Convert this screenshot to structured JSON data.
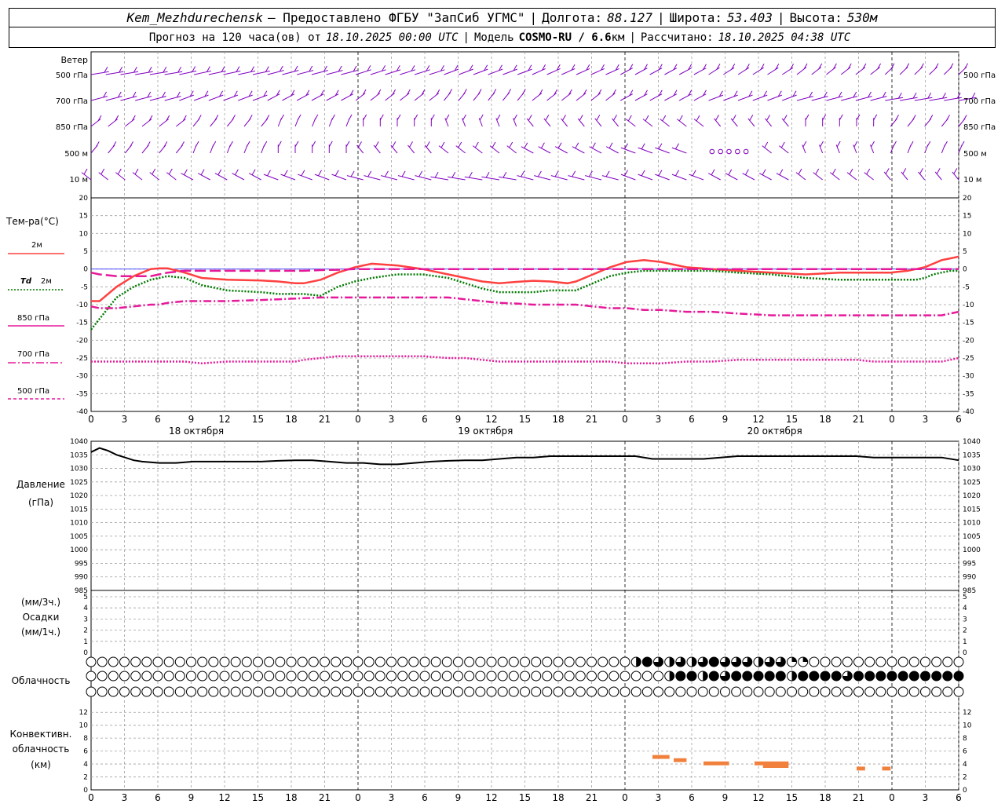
{
  "header": {
    "station": "Kem_Mezhdurechensk",
    "provider": "— Предоставлено ФГБУ \"ЗапСиб УГМС\"",
    "lon_label": "Долгота:",
    "lon_value": "88.127",
    "lat_label": "Широта:",
    "lat_value": "53.403",
    "alt_label": "Высота:",
    "alt_value": "530м",
    "forecast_prefix": "Прогноз на 120 часа(ов) от",
    "forecast_start": "18.10.2025 00:00 UTC",
    "model_label": "Модель",
    "model_name": "COSMO-RU / 6.6",
    "model_unit": "км",
    "calc_label": "Рассчитано:",
    "calc_time": "18.10.2025 04:38 UTC"
  },
  "labels": {
    "wind": "Ветер",
    "wind_levels": [
      "500 гПа",
      "700 гПа",
      "850 гПа",
      "500 м",
      "10 м"
    ],
    "temp_title": "Тем-ра(°С)",
    "t2m": "2м",
    "td_a": "Td",
    "td_b": "2м",
    "t850": "850 гПа",
    "t700": "700 гПа",
    "t500": "500 гПа",
    "pressure_a": "Давление",
    "pressure_b": "(гПа)",
    "precip_a": "(мм/3ч.)",
    "precip_b": "Осадки",
    "precip_c": "(мм/1ч.)",
    "cloud": "Облачность",
    "conv_a": "Конвективн.",
    "conv_b": "облачность",
    "conv_c": "(км)"
  },
  "colors": {
    "t2m": "#ff4040",
    "td2m": "#007a00",
    "t850": "#e6199a",
    "t700": "#e6199a",
    "t500": "#e6199a",
    "wind": "#8000c0",
    "pressure": "#000000",
    "convective": "#f0803c",
    "zero_line": "#3030ff",
    "grid": "#a0a0a0"
  },
  "chart_data": [
    {
      "type": "line",
      "panel": "temperature",
      "x_hours": [
        0,
        1,
        3,
        5,
        7,
        8,
        9,
        11,
        13,
        16,
        20,
        22,
        24,
        25,
        27,
        29,
        31,
        32,
        33,
        36,
        39,
        42,
        44,
        46,
        48,
        50,
        52,
        54,
        56,
        57,
        59,
        61,
        63,
        65,
        67,
        70,
        73,
        76,
        80,
        84,
        88,
        90,
        92,
        94,
        96,
        97,
        98,
        99,
        100,
        101,
        102
      ],
      "x_ticks": [
        "0",
        "3",
        "6",
        "9",
        "12",
        "15",
        "18",
        "21",
        "0",
        "3",
        "6",
        "9",
        "12",
        "15",
        "18",
        "21",
        "0",
        "3",
        "6",
        "9",
        "12",
        "15",
        "18",
        "21",
        "0",
        "3",
        "6"
      ],
      "date_labels": [
        "18 октября",
        "19 октября",
        "20 октября"
      ],
      "ylim": [
        -40,
        20
      ],
      "y_ticks": [
        20,
        15,
        10,
        5,
        0,
        -5,
        -10,
        -15,
        -20,
        -25,
        -30,
        -35,
        -40
      ],
      "series": [
        {
          "name": "2м",
          "style": "solid",
          "values": [
            -9,
            -9,
            -5,
            -2,
            0,
            0.2,
            0.2,
            -1,
            -2.5,
            -3,
            -3.2,
            -3.5,
            -4,
            -4,
            -3,
            -1,
            0.5,
            1,
            1.5,
            1,
            0,
            -1.5,
            -2.5,
            -3.5,
            -4,
            -3.6,
            -3.3,
            -3.5,
            -4,
            -3.5,
            -1.5,
            0.5,
            2,
            2.5,
            2,
            0.5,
            0,
            -0.5,
            -1,
            -1.5,
            -1,
            -1,
            -1,
            -1,
            -0.5,
            0,
            0.5,
            1.5,
            2.5,
            3,
            3.5
          ]
        },
        {
          "name": "Td 2м",
          "style": "dotted",
          "values": [
            -17,
            -14,
            -8,
            -5,
            -3,
            -2.5,
            -2,
            -2.5,
            -4.5,
            -6,
            -6.5,
            -7,
            -7,
            -7,
            -7.5,
            -5,
            -3.5,
            -3,
            -2.5,
            -1.5,
            -1.5,
            -2.5,
            -4,
            -5.5,
            -6.5,
            -6.5,
            -6.5,
            -6,
            -6,
            -6,
            -4,
            -2,
            -1,
            -0.5,
            -0.5,
            -0.5,
            -0.5,
            -1,
            -1.5,
            -2.5,
            -3,
            -3,
            -3,
            -3,
            -3,
            -3,
            -2.5,
            -1.5,
            -1,
            -0.5,
            -0.5
          ]
        },
        {
          "name": "850 гПа",
          "style": "dashdot",
          "values": [
            -10.5,
            -11,
            -11,
            -10.5,
            -10,
            -10,
            -9.5,
            -9,
            -9,
            -9,
            -8.7,
            -8.5,
            -8.3,
            -8.2,
            -8,
            -8,
            -8,
            -8,
            -8,
            -8,
            -8,
            -8,
            -8.5,
            -9,
            -9.5,
            -9.7,
            -10,
            -10,
            -10,
            -10,
            -10.5,
            -11,
            -11,
            -11.5,
            -11.5,
            -12,
            -12,
            -12.5,
            -13,
            -13,
            -13,
            -13,
            -13,
            -13,
            -13,
            -13,
            -13,
            -13,
            -13,
            -12.5,
            -12
          ]
        },
        {
          "name": "700 гПа",
          "style": "dashed",
          "values": [
            -1,
            -1.5,
            -2,
            -2,
            -2,
            -1.5,
            -1,
            -0.5,
            -0.5,
            -0.5,
            -0.5,
            -0.5,
            -0.5,
            -0.5,
            -0.3,
            -0.2,
            0,
            0,
            0,
            0,
            0,
            0,
            0,
            0,
            0,
            0,
            0,
            0,
            0,
            0,
            0,
            0,
            0,
            0,
            0,
            0,
            0,
            0,
            0,
            0,
            0,
            0,
            0,
            0,
            0,
            0,
            0,
            0,
            0,
            0,
            0
          ]
        },
        {
          "name": "500 гПа",
          "style": "dotted",
          "values": [
            -26,
            -26,
            -26,
            -26,
            -26,
            -26,
            -26,
            -26,
            -26.5,
            -26,
            -26,
            -26,
            -26,
            -25.5,
            -25,
            -24.5,
            -24.5,
            -24.5,
            -24.5,
            -24.5,
            -24.5,
            -25,
            -25,
            -25.5,
            -26,
            -26,
            -26,
            -26,
            -26,
            -26,
            -26,
            -26,
            -26.5,
            -26.5,
            -26.5,
            -26,
            -26,
            -25.5,
            -25.5,
            -25.5,
            -25.5,
            -25.5,
            -26,
            -26,
            -26,
            -26,
            -26,
            -26,
            -26,
            -25.5,
            -25
          ]
        }
      ]
    },
    {
      "type": "line",
      "panel": "pressure",
      "ylim": [
        985,
        1040
      ],
      "y_ticks": [
        1040,
        1035,
        1030,
        1025,
        1020,
        1015,
        1010,
        1005,
        1000,
        995,
        990,
        985
      ],
      "x_hours": [
        0,
        1,
        2,
        3,
        4,
        5,
        6,
        8,
        10,
        12,
        14,
        16,
        18,
        20,
        22,
        24,
        26,
        28,
        30,
        32,
        34,
        36,
        38,
        40,
        42,
        44,
        46,
        48,
        50,
        52,
        54,
        56,
        58,
        60,
        62,
        64,
        66,
        68,
        70,
        72,
        74,
        76,
        78,
        80,
        82,
        84,
        86,
        88,
        90,
        92,
        94,
        96,
        98,
        100,
        102
      ],
      "values": [
        1036,
        1037.5,
        1036.5,
        1035,
        1034,
        1033,
        1032.5,
        1032,
        1032,
        1032.5,
        1032.5,
        1032.5,
        1032.5,
        1032.5,
        1032.8,
        1033,
        1033,
        1032.5,
        1032,
        1032,
        1031.5,
        1031.5,
        1032,
        1032.5,
        1032.8,
        1033,
        1033,
        1033.5,
        1034,
        1034,
        1034.5,
        1034.5,
        1034.5,
        1034.5,
        1034.5,
        1034.5,
        1033.5,
        1033.5,
        1033.5,
        1033.5,
        1034,
        1034.5,
        1034.5,
        1034.5,
        1034.5,
        1034.5,
        1034.5,
        1034.5,
        1034.5,
        1034,
        1034,
        1034,
        1034,
        1034,
        1033,
        1032.5
      ],
      "series_name": ""
    },
    {
      "type": "bar",
      "panel": "precipitation",
      "ylim": [
        0,
        5
      ],
      "y_ticks": [
        5,
        4,
        3,
        2,
        1,
        0
      ],
      "values": []
    },
    {
      "type": "heatmap",
      "panel": "cloud_cover",
      "rows": 3,
      "columns": 79,
      "note_levels": "fraction of circle filled, 0..1, per column",
      "upper": [
        0,
        0,
        0,
        0,
        0,
        0,
        0,
        0,
        0,
        0,
        0,
        0,
        0,
        0,
        0,
        0,
        0,
        0,
        0,
        0,
        0,
        0,
        0,
        0,
        0,
        0,
        0,
        0,
        0,
        0,
        0,
        0,
        0,
        0,
        0,
        0,
        0,
        0,
        0,
        0,
        0,
        0,
        0,
        0,
        0,
        0,
        0,
        0,
        0,
        0.5,
        1,
        0.75,
        0.5,
        0.75,
        0.5,
        0.75,
        1,
        0.75,
        0.75,
        0.75,
        0.5,
        0.75,
        0.75,
        0.25,
        0.25,
        0,
        0,
        0,
        0,
        0,
        0,
        0,
        0,
        0,
        0,
        0,
        0,
        0,
        0,
        0,
        0,
        0.25,
        0,
        0,
        0,
        0.5,
        0.5,
        0.5,
        0.5,
        0.75,
        0.5,
        0.75,
        0.75,
        0.75,
        1,
        0.75,
        0.75,
        0.75,
        0.75,
        1
      ],
      "middle": [
        0,
        0,
        0,
        0,
        0,
        0,
        0,
        0,
        0,
        0,
        0,
        0,
        0,
        0,
        0,
        0,
        0,
        0,
        0,
        0,
        0,
        0,
        0,
        0,
        0,
        0,
        0,
        0,
        0,
        0,
        0,
        0,
        0,
        0,
        0,
        0,
        0,
        0,
        0,
        0,
        0,
        0,
        0,
        0,
        0,
        0,
        0,
        0,
        0,
        0,
        0,
        0,
        0.5,
        1,
        1,
        0.5,
        1,
        0.75,
        1,
        1,
        1,
        1,
        1,
        0.5,
        1,
        1,
        1,
        1,
        0.75,
        1,
        1,
        1,
        1,
        1,
        1,
        1,
        1,
        1,
        1,
        1,
        1,
        1,
        1,
        1,
        1,
        1,
        1,
        1,
        1,
        1,
        1,
        1,
        1,
        1,
        0.5,
        1,
        0.5,
        1
      ],
      "lower": []
    },
    {
      "type": "bar",
      "panel": "convective_cloud",
      "ylim": [
        0,
        13
      ],
      "y_ticks": [
        12,
        10,
        8,
        6,
        4,
        2,
        0
      ],
      "segments": [
        {
          "start_h": 66,
          "end_h": 68,
          "base": 4.8,
          "top": 5.4
        },
        {
          "start_h": 68.5,
          "end_h": 70,
          "base": 4.3,
          "top": 4.9
        },
        {
          "start_h": 72,
          "end_h": 75,
          "base": 3.8,
          "top": 4.4
        },
        {
          "start_h": 78,
          "end_h": 82,
          "base": 3.8,
          "top": 4.4
        },
        {
          "start_h": 79,
          "end_h": 82,
          "base": 3.4,
          "top": 4.0
        },
        {
          "start_h": 90,
          "end_h": 91,
          "base": 3.0,
          "top": 3.6
        },
        {
          "start_h": 93,
          "end_h": 94,
          "base": 3.0,
          "top": 3.6
        }
      ]
    },
    {
      "type": "scatter",
      "panel": "wind",
      "levels": [
        "500 гПа",
        "700 гПа",
        "850 гПа",
        "500 м",
        "10 м"
      ],
      "calm_hours_500m": [
        73,
        74,
        75,
        76,
        77
      ]
    }
  ]
}
